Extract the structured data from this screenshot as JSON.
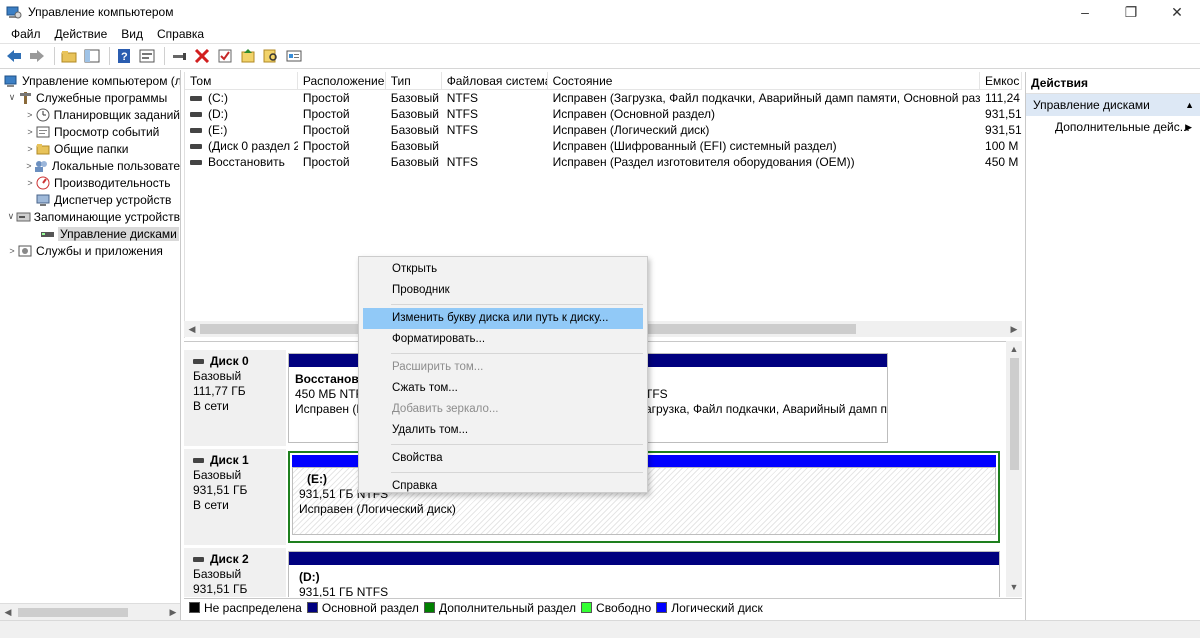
{
  "window": {
    "title": "Управление компьютером",
    "minimize": "–",
    "maximize": "❐",
    "close": "✕"
  },
  "menu": [
    "Файл",
    "Действие",
    "Вид",
    "Справка"
  ],
  "tree": {
    "root": "Управление компьютером (лс",
    "items": [
      {
        "label": "Служебные программы",
        "level": 1,
        "arrow": "v",
        "icon": "tools-icon"
      },
      {
        "label": "Планировщик заданий",
        "level": 2,
        "arrow": ">",
        "icon": "clock-icon"
      },
      {
        "label": "Просмотр событий",
        "level": 2,
        "arrow": ">",
        "icon": "event-viewer-icon"
      },
      {
        "label": "Общие папки",
        "level": 2,
        "arrow": ">",
        "icon": "shared-folder-icon"
      },
      {
        "label": "Локальные пользовате",
        "level": 2,
        "arrow": ">",
        "icon": "users-icon"
      },
      {
        "label": "Производительность",
        "level": 2,
        "arrow": ">",
        "icon": "performance-icon"
      },
      {
        "label": "Диспетчер устройств",
        "level": 2,
        "arrow": "",
        "icon": "device-manager-icon"
      },
      {
        "label": "Запоминающие устройств",
        "level": 1,
        "arrow": "v",
        "icon": "storage-icon"
      },
      {
        "label": "Управление дисками",
        "level": 2,
        "arrow": "",
        "icon": "disk-management-icon",
        "selected": true
      },
      {
        "label": "Службы и приложения",
        "level": 1,
        "arrow": ">",
        "icon": "services-icon"
      }
    ]
  },
  "volumes": {
    "columns": [
      "Том",
      "Расположение",
      "Тип",
      "Файловая система",
      "Состояние",
      "Емкос"
    ],
    "rows": [
      [
        "(C:)",
        "Простой",
        "Базовый",
        "NTFS",
        "Исправен (Загрузка, Файл подкачки, Аварийный дамп памяти, Основной раздел)",
        "111,24"
      ],
      [
        "(D:)",
        "Простой",
        "Базовый",
        "NTFS",
        "Исправен (Основной раздел)",
        "931,51"
      ],
      [
        "(E:)",
        "Простой",
        "Базовый",
        "NTFS",
        "Исправен (Логический диск)",
        "931,51"
      ],
      [
        "(Диск 0 раздел 2)",
        "Простой",
        "Базовый",
        "",
        "Исправен (Шифрованный (EFI) системный раздел)",
        "100 М"
      ],
      [
        "Восстановить",
        "Простой",
        "Базовый",
        "NTFS",
        "Исправен (Раздел изготовителя оборудования (OEM))",
        "450 М"
      ]
    ]
  },
  "disks": [
    {
      "name": "Диск 0",
      "type": "Базовый",
      "size": "111,77 ГБ",
      "status": "В сети",
      "partitions": [
        {
          "name": "Восстанови",
          "line2": "450 МБ NTF",
          "line3": "Исправен (Р"
        },
        {
          "name": "",
          "line2": "ТFS",
          "line3": "агрузка, Файл подкачки, Аварийный дамп па"
        }
      ]
    },
    {
      "name": "Диск 1",
      "type": "Базовый",
      "size": "931,51 ГБ",
      "status": "В сети",
      "partitions": [
        {
          "name": "(E:)",
          "line2": "931,51 ГБ NTFS",
          "line3": "Исправен (Логический диск)"
        }
      ]
    },
    {
      "name": "Диск 2",
      "type": "Базовый",
      "size": "931,51 ГБ",
      "status": "",
      "partitions": [
        {
          "name": "(D:)",
          "line2": "931,51 ГБ NTFS",
          "line3": ""
        }
      ]
    }
  ],
  "legend": [
    {
      "label": "Не распределена",
      "color": "#000000"
    },
    {
      "label": "Основной раздел",
      "color": "#00007f"
    },
    {
      "label": "Дополнительный раздел",
      "color": "#008000"
    },
    {
      "label": "Свободно",
      "color": "#33ff33"
    },
    {
      "label": "Логический диск",
      "color": "#0000ff"
    }
  ],
  "actions": {
    "header": "Действия",
    "section": "Управление дисками",
    "item": "Дополнительные дейс..."
  },
  "context_menu": {
    "items": [
      {
        "label": "Открыть",
        "enabled": true
      },
      {
        "label": "Проводник",
        "enabled": true
      },
      {
        "label": "Изменить букву диска или путь к диску...",
        "enabled": true,
        "highlighted": true
      },
      {
        "label": "Форматировать...",
        "enabled": true
      },
      {
        "label": "Расширить том...",
        "enabled": false
      },
      {
        "label": "Сжать том...",
        "enabled": true
      },
      {
        "label": "Добавить зеркало...",
        "enabled": false
      },
      {
        "label": "Удалить том...",
        "enabled": true
      },
      {
        "label": "Свойства",
        "enabled": true
      },
      {
        "label": "Справка",
        "enabled": true
      }
    ]
  }
}
